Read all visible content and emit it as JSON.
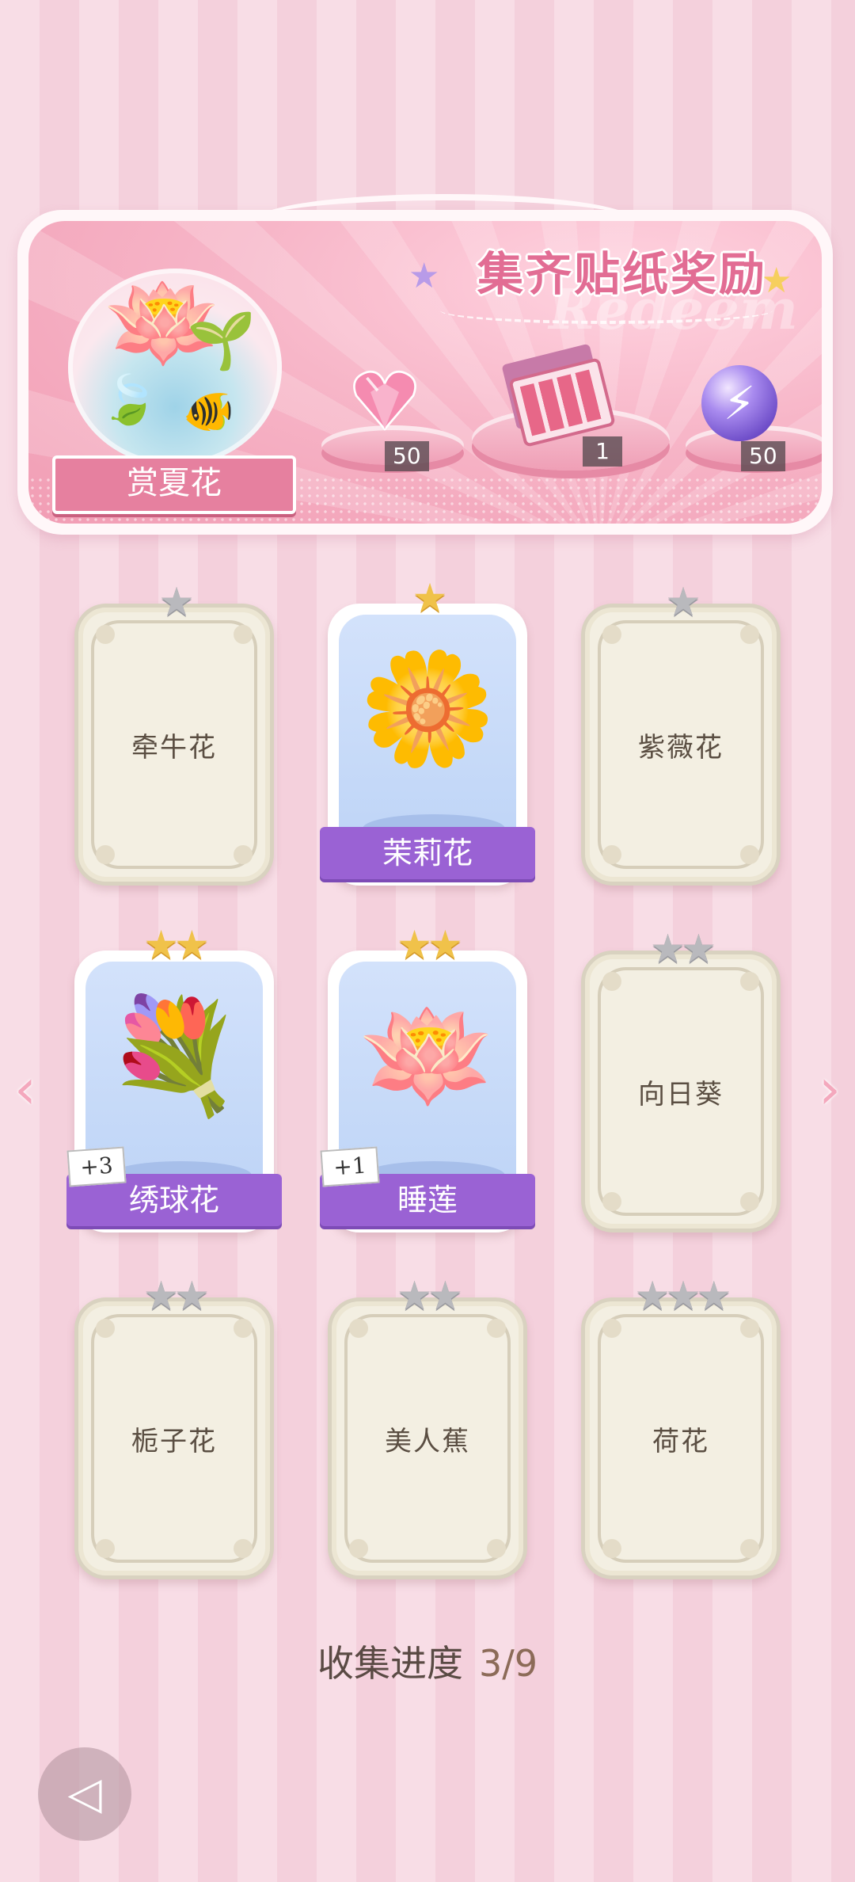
{
  "banner": {
    "title": "集齐贴纸奖励",
    "watermark": "Redeem",
    "event_label": "赏夏花",
    "rewards": [
      {
        "icon": "pink-heart-gem-icon",
        "count": "50"
      },
      {
        "icon": "flower-gift-box-icon",
        "count": "1"
      },
      {
        "icon": "purple-energy-orb-icon",
        "count": "50"
      }
    ]
  },
  "cards": [
    {
      "name": "牵牛花",
      "stars": 1,
      "collected": false
    },
    {
      "name": "茉莉花",
      "stars": 1,
      "collected": true
    },
    {
      "name": "紫薇花",
      "stars": 1,
      "collected": false
    },
    {
      "name": "绣球花",
      "stars": 2,
      "collected": true,
      "extra": "+3"
    },
    {
      "name": "睡莲",
      "stars": 2,
      "collected": true,
      "extra": "+1"
    },
    {
      "name": "向日葵",
      "stars": 2,
      "collected": false
    },
    {
      "name": "栀子花",
      "stars": 2,
      "collected": false
    },
    {
      "name": "美人蕉",
      "stars": 2,
      "collected": false
    },
    {
      "name": "荷花",
      "stars": 3,
      "collected": false
    }
  ],
  "progress": {
    "label": "收集进度",
    "value": "3/9"
  },
  "colors": {
    "accent_pink": "#e6809f",
    "ribbon_purple": "#9a62d4",
    "card_locked": "#f3efe2",
    "star_gold": "#f0c24a",
    "star_silver": "#b9b9bd"
  },
  "icons": {
    "prev": "chevron-left-icon",
    "next": "chevron-right-icon",
    "back": "back-triangle-icon"
  }
}
